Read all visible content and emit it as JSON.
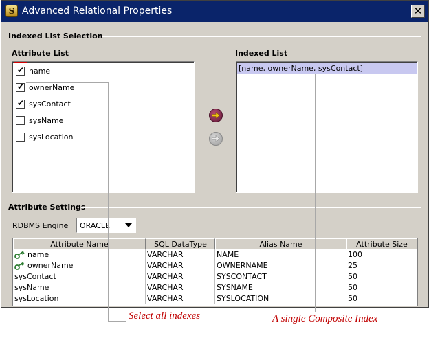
{
  "window": {
    "title": "Advanced Relational Properties",
    "app_icon_letter": "S"
  },
  "indexed_section": {
    "title": "Indexed List Selection",
    "attribute_list_label": "Attribute List",
    "indexed_list_label": "Indexed List",
    "attributes": [
      {
        "label": "name",
        "checked": true
      },
      {
        "label": "ownerName",
        "checked": true
      },
      {
        "label": "sysContact",
        "checked": true
      },
      {
        "label": "sysName",
        "checked": false
      },
      {
        "label": "sysLocation",
        "checked": false
      }
    ],
    "indexed_items": [
      "[name, ownerName, sysContact]"
    ]
  },
  "settings_section": {
    "title": "Attribute Settings",
    "rdbms_label": "RDBMS Engine",
    "rdbms_value": "ORACLE",
    "columns": [
      "Attribute Name",
      "SQL DataType",
      "Alias Name",
      "Attribute Size"
    ],
    "rows": [
      {
        "name": "name",
        "key": true,
        "type": "VARCHAR",
        "alias": "NAME",
        "size": "100"
      },
      {
        "name": "ownerName",
        "key": true,
        "type": "VARCHAR",
        "alias": "OWNERNAME",
        "size": "25"
      },
      {
        "name": "sysContact",
        "key": false,
        "type": "VARCHAR",
        "alias": "SYSCONTACT",
        "size": "50"
      },
      {
        "name": "sysName",
        "key": false,
        "type": "VARCHAR",
        "alias": "SYSNAME",
        "size": "50"
      },
      {
        "name": "sysLocation",
        "key": false,
        "type": "VARCHAR",
        "alias": "SYSLOCATION",
        "size": "50"
      }
    ]
  },
  "annotations": {
    "select_all": "Select all indexes",
    "composite": "A single Composite Index"
  },
  "colors": {
    "titlebar": "#0a246a",
    "dialog_bg": "#d4d0c8",
    "selection": "#c8c8f0",
    "annotation_text": "#c00000",
    "highlight_box": "#d40000"
  },
  "icons": {
    "close": "close-icon",
    "add": "arrow-right-icon",
    "remove": "arrow-left-icon",
    "key": "key-icon"
  }
}
